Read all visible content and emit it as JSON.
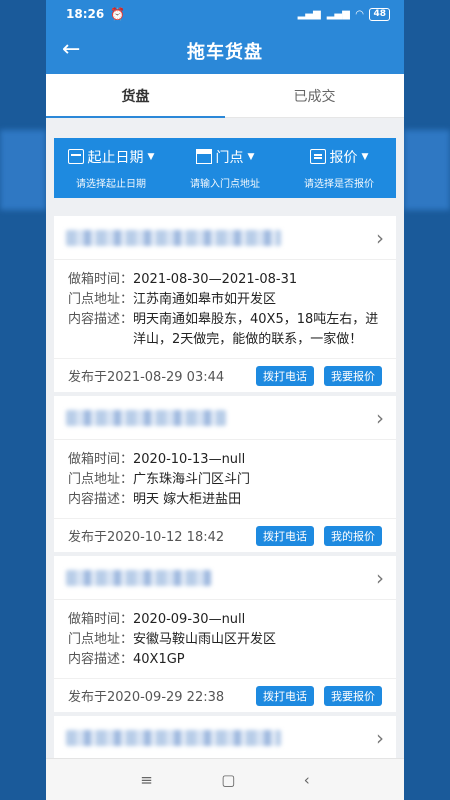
{
  "status": {
    "time": "18:26",
    "battery": "48"
  },
  "header": {
    "title": "拖车货盘",
    "back_icon": "arrow-left-icon"
  },
  "tabs": [
    {
      "label": "货盘",
      "active": true
    },
    {
      "label": "已成交",
      "active": false
    }
  ],
  "filters": [
    {
      "label": "起止日期",
      "sub": "请选择起止日期",
      "icon": "calendar-icon"
    },
    {
      "label": "门点",
      "sub": "请输入门点地址",
      "icon": "store-icon"
    },
    {
      "label": "报价",
      "sub": "请选择是否报价",
      "icon": "document-icon"
    }
  ],
  "labels": {
    "time": "做箱时间：",
    "address": "门点地址：",
    "desc": "内容描述："
  },
  "listings": [
    {
      "time": "2021-08-30—2021-08-31",
      "address": "江苏南通如皋市如开发区",
      "desc": "明天南通如皋股东，40X5，18吨左右，进洋山，2天做完，能做的联系，一家做！",
      "published": "发布于2021-08-29 03:44",
      "call_label": "拨打电话",
      "quote_label": "我要报价"
    },
    {
      "time": "2020-10-13—null",
      "address": "广东珠海斗门区斗门",
      "desc": "明天 嫁大柜进盐田",
      "published": "发布于2020-10-12 18:42",
      "call_label": "拨打电话",
      "quote_label": "我的报价"
    },
    {
      "time": "2020-09-30—null",
      "address": "安徽马鞍山雨山区开发区",
      "desc": "40X1GP",
      "published": "发布于2020-09-29 22:38",
      "call_label": "拨打电话",
      "quote_label": "我要报价"
    }
  ],
  "nav": {
    "menu": "≡",
    "home": "▢",
    "back": "‹"
  }
}
